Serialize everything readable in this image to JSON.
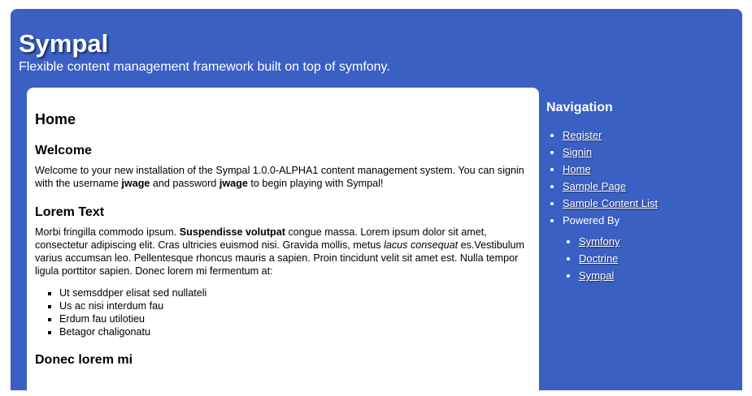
{
  "header": {
    "title": "Sympal",
    "tagline": "Flexible content management framework built on top of symfony."
  },
  "content": {
    "page_title": "Home",
    "welcome": {
      "heading": "Welcome",
      "text_1": "Welcome to your new installation of the Sympal 1.0.0-ALPHA1 content management system. You can signin with the username ",
      "username": "jwage",
      "text_2": " and password ",
      "password": "jwage",
      "text_3": " to begin playing with Sympal!"
    },
    "lorem": {
      "heading": "Lorem Text",
      "text_1": "Morbi fringilla commodo ipsum. ",
      "bold": "Suspendisse volutpat",
      "text_2": " congue massa. Lorem ipsum dolor sit amet, consectetur adipiscing elit. Cras ultricies euismod nisi. Gravida mollis, metus ",
      "italic": "lacus consequat",
      "text_3": " es.Vestibulum varius accumsan leo. Pellentesque rhoncus mauris a sapien. Proin tincidunt velit sit amet est. Nulla tempor ligula porttitor sapien. Donec lorem mi fermentum at:",
      "items": [
        "Ut semsddper elisat sed nullateli",
        "Us ac nisi interdum fau",
        "Erdum fau utilotieu",
        "Betagor chaligonatu"
      ]
    },
    "donec": {
      "heading": "Donec lorem mi"
    }
  },
  "nav": {
    "heading": "Navigation",
    "items": [
      "Register",
      "Signin",
      "Home",
      "Sample Page",
      "Sample Content List"
    ],
    "powered_by_label": "Powered By",
    "powered_by": [
      "Symfony",
      "Doctrine",
      "Sympal"
    ]
  },
  "colors": {
    "frame": "#3a60c4",
    "content_bg": "#ffffff",
    "text": "#000000"
  }
}
